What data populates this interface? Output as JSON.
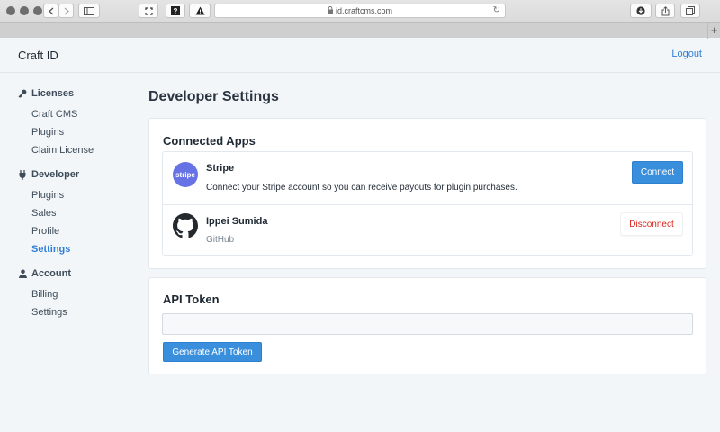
{
  "browser": {
    "url": "id.craftcms.com",
    "reload_glyph": "↻",
    "new_tab_glyph": "+"
  },
  "header": {
    "brand": "Craft ID",
    "logout_label": "Logout"
  },
  "sidebar": {
    "sections": [
      {
        "label": "Licenses",
        "icon": "key-icon",
        "items": [
          "Craft CMS",
          "Plugins",
          "Claim License"
        ]
      },
      {
        "label": "Developer",
        "icon": "plug-icon",
        "items": [
          "Plugins",
          "Sales",
          "Profile",
          "Settings"
        ]
      },
      {
        "label": "Account",
        "icon": "user-icon",
        "items": [
          "Billing",
          "Settings"
        ]
      }
    ],
    "active_item": "Developer / Settings"
  },
  "main": {
    "page_title": "Developer Settings",
    "connected_apps": {
      "title": "Connected Apps",
      "apps": [
        {
          "logo_text": "stripe",
          "name": "Stripe",
          "description": "Connect your Stripe account so you can receive payouts for plugin purchases.",
          "button_label": "Connect"
        },
        {
          "logo": "github-icon",
          "name": "Ippei Sumida",
          "description": "GitHub",
          "button_label": "Disconnect"
        }
      ]
    },
    "api_token": {
      "title": "API Token",
      "value": "",
      "button_label": "Generate API Token"
    }
  },
  "colors": {
    "accent": "#3a8fdc",
    "link": "#2f7fd6",
    "danger": "#d9251d",
    "stripe": "#6772e5"
  }
}
